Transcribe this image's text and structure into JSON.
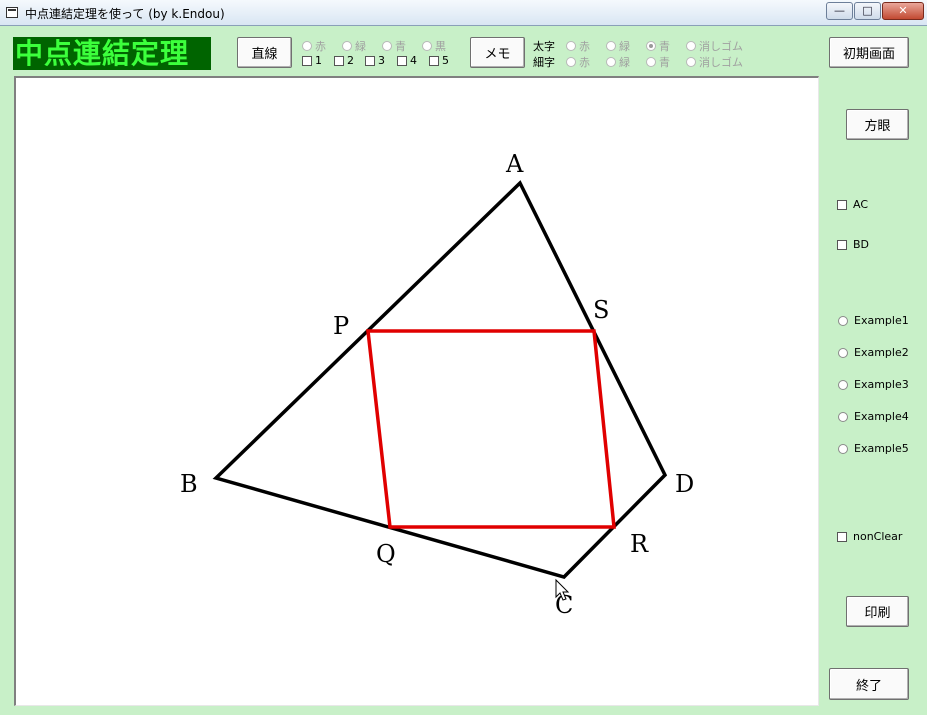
{
  "window": {
    "title": "中点連結定理を使って (by k.Endou)",
    "minimize": "—",
    "maximize": "□",
    "close": "✕"
  },
  "heading": "中点連結定理",
  "toolbar": {
    "line_button": "直線",
    "line_colors": [
      "赤",
      "緑",
      "青",
      "黒"
    ],
    "line_numbers": [
      "1",
      "2",
      "3",
      "4",
      "5"
    ],
    "memo_button": "メモ",
    "thick_label": "太字",
    "thin_label": "細字",
    "thick_options": [
      "赤",
      "緑",
      "青",
      "消しゴム"
    ],
    "thin_options": [
      "赤",
      "緑",
      "青",
      "消しゴム"
    ],
    "thick_selected": "青",
    "reset_button": "初期画面"
  },
  "sidebar": {
    "grid_button": "方眼",
    "checks": [
      "AC",
      "BD"
    ],
    "examples": [
      "Example1",
      "Example2",
      "Example3",
      "Example4",
      "Example5"
    ],
    "nonclear": "nonClear",
    "print_button": "印刷",
    "exit_button": "終了"
  },
  "figure": {
    "vertices": {
      "A": "A",
      "B": "B",
      "C": "C",
      "D": "D"
    },
    "midpoints": {
      "P": "P",
      "Q": "Q",
      "R": "R",
      "S": "S"
    },
    "quad_color": "#000000",
    "midpoint_color": "#e00000"
  }
}
